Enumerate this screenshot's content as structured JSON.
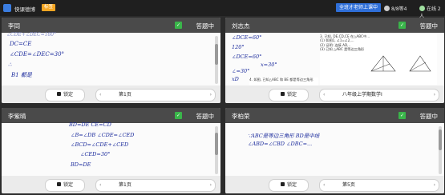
{
  "topbar": {
    "app_name": "快课德博",
    "tag": "标签",
    "start_button": "全班才老师上课中",
    "people_count": "8/8等4",
    "online": "在线 2人"
  },
  "panels": [
    {
      "student": "李同",
      "status": "答题中",
      "lock_label": "锁定",
      "page_label": "第1页",
      "handwriting": [
        "∠CDE+∠DEC=180°",
        "DC=CE",
        "∠CDE=∠DEC=30°",
        "∴",
        "B1 都是"
      ]
    },
    {
      "student": "刘志杰",
      "status": "答题中",
      "lock_label": "锁定",
      "page_label": "八年级上学期数学I",
      "handwriting": [
        "∠DCE=60°",
        "120°",
        "∠DCE=60°",
        "x=30°",
        "∠=30°",
        "xD"
      ],
      "doc_lines": [
        "3. 已知, DE,CD,CE 在△ABC中...",
        "(1) 如图1, ∠1=∠2,...",
        "(2) 证明: 连接 AD,..",
        "(3) 已知 △ABC 是等边三角形",
        "4. 如图, 已知△ABC 和 BE 都是等边三角形",
        "则 ∠AFB=?"
      ]
    },
    {
      "student": "李紫晴",
      "status": "答题中",
      "lock_label": "锁定",
      "page_label": "第1页",
      "handwriting": [
        "BD=DE  CE=CD",
        "∠B=∠DB  ∠CDE=∠CED",
        "∠BCD=∠CDE+∠CED",
        "∠CED=30°",
        "BD=DE"
      ]
    },
    {
      "student": "李柏荣",
      "status": "答题中",
      "lock_label": "锁定",
      "page_label": "第5页",
      "handwriting": [
        "∵ABC是等边三角形  BD是中线",
        "∠ABD=∠CBD  ∠DBC=..."
      ]
    }
  ]
}
